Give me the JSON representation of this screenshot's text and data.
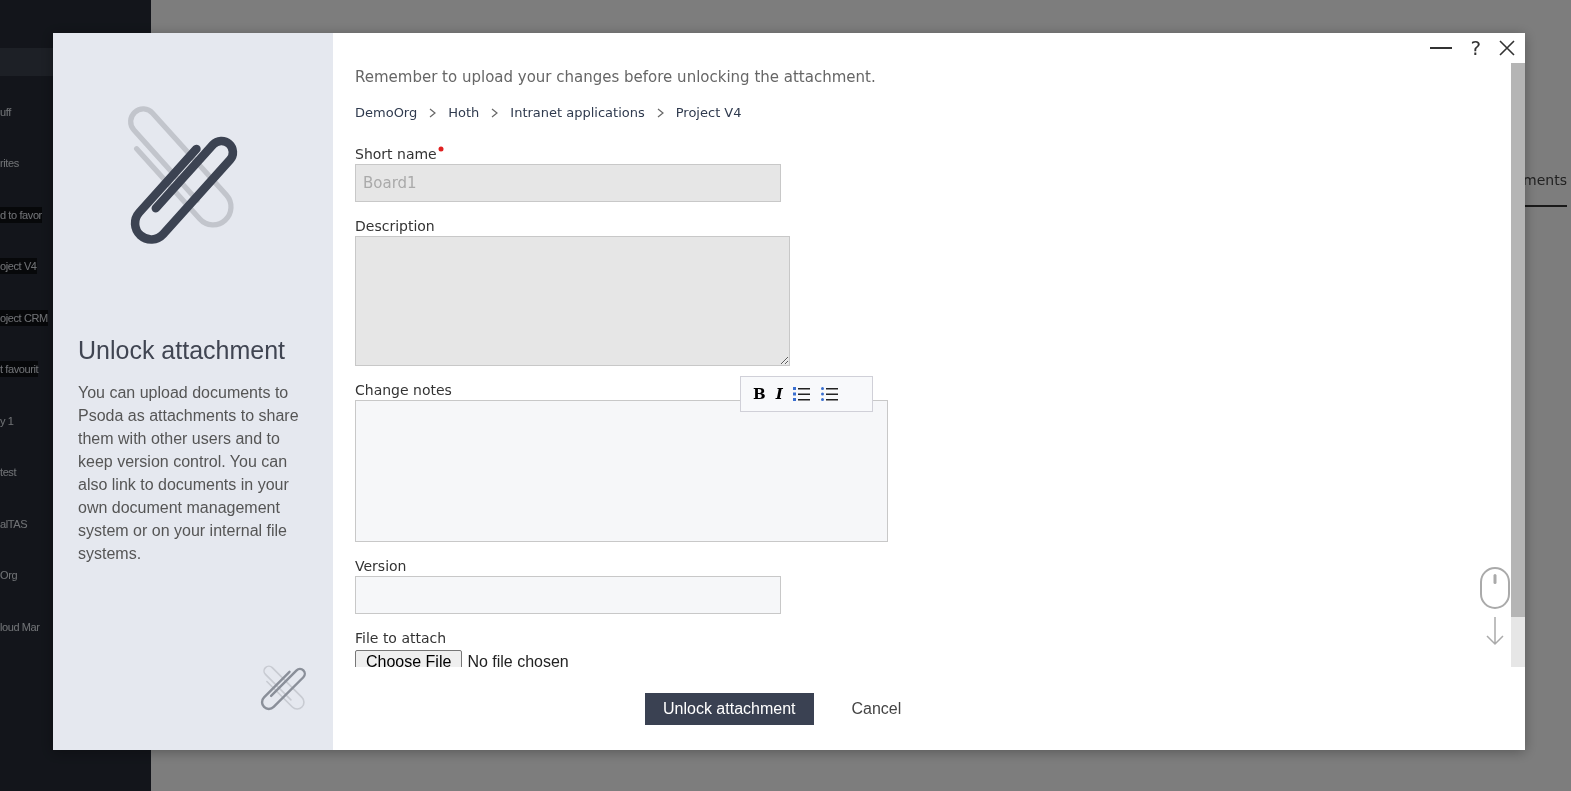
{
  "background": {
    "sidebar_items": [
      {
        "label": "uff",
        "selected": false
      },
      {
        "label": "rites",
        "selected": false
      },
      {
        "label": "d to favor",
        "selected": true
      },
      {
        "label": "oject V4",
        "selected": true
      },
      {
        "label": "oject CRM",
        "selected": true
      },
      {
        "label": "t favourit",
        "selected": true
      },
      {
        "label": "y 1",
        "selected": false
      },
      {
        "label": "test",
        "selected": false
      },
      {
        "label": "alTAS",
        "selected": false
      },
      {
        "label": "Org",
        "selected": false
      },
      {
        "label": "loud Mar",
        "selected": false
      }
    ],
    "tab": "ments"
  },
  "dialog": {
    "help": "?",
    "side": {
      "title": "Unlock attachment",
      "text": "You can upload documents to Psoda as attachments to share them with other users and to keep version control. You can also link to documents in your own document management system or on your internal file systems."
    },
    "notice": "Remember to upload your changes before unlocking the attachment.",
    "breadcrumb": [
      "DemoOrg",
      "Hoth",
      "Intranet applications",
      "Project V4"
    ],
    "fields": [
      {
        "kind": "text",
        "label": "Short name",
        "required": true,
        "disabled": true,
        "value": "Board1"
      },
      {
        "kind": "textarea",
        "label": "Description",
        "required": false,
        "disabled": true
      },
      {
        "kind": "richtext",
        "label": "Change notes",
        "required": false,
        "disabled": false,
        "toolbar": [
          "B",
          "I"
        ]
      },
      {
        "kind": "text",
        "label": "Version",
        "required": false,
        "disabled": false
      },
      {
        "kind": "file",
        "label": "File to attach",
        "required": false,
        "disabled": false,
        "button": "Choose File",
        "status": "No file chosen"
      }
    ],
    "buttons": {
      "primary": "Unlock attachment",
      "secondary": "Cancel"
    }
  }
}
